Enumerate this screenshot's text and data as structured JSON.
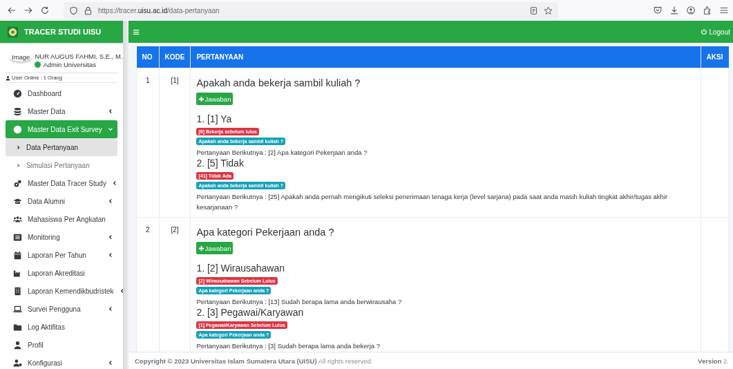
{
  "browser": {
    "url": "https://tracer.**uisu.ac.id**/data-pertanyaan"
  },
  "brand": {
    "title": "TRACER STUDI UISU"
  },
  "user_panel": {
    "image_alt": "Image",
    "name": "NUR AUGUS FAHMI, S.E., M.",
    "role": "Admin Universitas",
    "online": "User Online : 1 Orang"
  },
  "sidebar": {
    "items": [
      {
        "label": "Dashboard",
        "selected": false
      },
      {
        "label": "Master Data",
        "expanded": false,
        "selected": false
      },
      {
        "label": "Master Data Exit Survey",
        "expanded": true,
        "selected": true,
        "children": [
          {
            "label": "Data Pertanyaan",
            "selected": true
          },
          {
            "label": "Simulasi Pertanyaan",
            "selected": false
          }
        ]
      },
      {
        "label": "Master Data Tracer Study",
        "expanded": false,
        "selected": false
      },
      {
        "label": "Data Alumni",
        "expanded": false,
        "selected": false
      },
      {
        "label": "Mahasiswa Per Angkatan",
        "selected": false
      },
      {
        "label": "Monitoring",
        "expanded": false,
        "selected": false
      },
      {
        "label": "Laporan Per Tahun",
        "expanded": false,
        "selected": false
      },
      {
        "label": "Laporan Akreditasi",
        "selected": false
      },
      {
        "label": "Laporan Kemendikbudristek",
        "expanded": false,
        "selected": false
      },
      {
        "label": "Survei Pengguna",
        "expanded": false,
        "selected": false
      },
      {
        "label": "Log Aktifitas",
        "selected": false
      },
      {
        "label": "Profil",
        "selected": false
      },
      {
        "label": "Konfigurasi",
        "expanded": false,
        "selected": false
      }
    ]
  },
  "topbar": {
    "logout": "Logout"
  },
  "table": {
    "columns": [
      "NO",
      "KODE",
      "PERTANYAAN",
      "AKSI"
    ],
    "rows": [
      {
        "no": "1",
        "kode": "[1]",
        "question": "Apakah anda bekerja sambil kuliah ?",
        "add_button": "Jawaban",
        "answers": [
          {
            "title": "1. [1] Ya",
            "tags": [
              {
                "text": "[6] Bekerja sebelum lulus",
                "color": "#dc3545"
              },
              {
                "text": "Apakah anda bekerja sambil kuliah ?",
                "color": "#17a2b8"
              }
            ],
            "next": "Pertanyaan Berikutnya : [2] Apa kategori Pekerjaan anda ?"
          },
          {
            "title": "2. [5] Tidak",
            "tags": [
              {
                "text": "[41] Tidak Ada",
                "color": "#dc3545"
              },
              {
                "text": "Apakah anda bekerja sambil kuliah ?",
                "color": "#17a2b8"
              }
            ],
            "next": "Pertanyaan Berikutnya : [25] Apakah anda pernah mengikuti seleksi penerimaan tenaga kerja (level sarjana) pada saat anda masih kuliah tingkat akhir/tugas akhir kesarjanaan ?"
          }
        ]
      },
      {
        "no": "2",
        "kode": "[2]",
        "question": "Apa kategori Pekerjaan anda ?",
        "add_button": "Jawaban",
        "answers": [
          {
            "title": "1. [2] Wirausahawan",
            "tags": [
              {
                "text": "[2] Wirausahawan Sebelum Lulus",
                "color": "#dc3545"
              },
              {
                "text": "Apa kategori Pekerjaan anda ?",
                "color": "#17a2b8"
              }
            ],
            "next": "Pertanyaan Berikutnya : [13] Sudah berapa lama anda berwirausaha ?"
          },
          {
            "title": "2. [3] Pegawai/Karyawan",
            "tags": [
              {
                "text": "[1] Pegawai/Karyawan Sebelum Lulus",
                "color": "#dc3545"
              },
              {
                "text": "Apa kategori Pekerjaan anda ?",
                "color": "#17a2b8"
              }
            ],
            "next": "Pertanyaan Berikutnya : [3] Sudah berapa lama anda bekerja ?"
          }
        ]
      }
    ]
  },
  "footer": {
    "copyright": "**Copyright © 2023 Universitas Islam Sumatera Utara (UISU)** All rights reserved.",
    "version": "**Version** 2."
  }
}
